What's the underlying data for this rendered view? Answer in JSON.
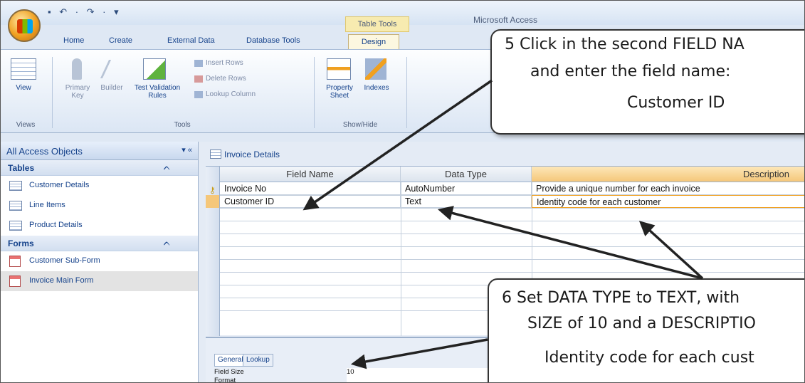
{
  "window": {
    "app_title": "Microsoft Access",
    "quick_access": "▪ ↶ · ↷ · ▾",
    "context_label": "Table Tools"
  },
  "ribbon_tabs": [
    "Home",
    "Create",
    "External Data",
    "Database Tools",
    "Design"
  ],
  "ribbon": {
    "view_label": "View",
    "primary_key_label": "Primary\nKey",
    "builder_label": "Builder",
    "test_validation_label": "Test Validation\nRules",
    "insert_rows_label": "Insert Rows",
    "delete_rows_label": "Delete Rows",
    "lookup_column_label": "Lookup Column",
    "property_sheet_label": "Property\nSheet",
    "indexes_label": "Indexes",
    "groups": [
      "Views",
      "Tools",
      "Show/Hide"
    ]
  },
  "nav_pane": {
    "header": "All Access Objects",
    "sections": [
      {
        "title": "Tables",
        "items": [
          "Customer Details",
          "Line Items",
          "Product Details"
        ]
      },
      {
        "title": "Forms",
        "items": [
          "Customer Sub-Form",
          "Invoice Main Form"
        ]
      }
    ]
  },
  "document": {
    "tab_label": "Invoice Details",
    "columns": [
      "Field Name",
      "Data Type",
      "Description"
    ],
    "rows": [
      {
        "field": "Invoice No",
        "type": "AutoNumber",
        "description": "Provide a unique number for each invoice"
      },
      {
        "field": "Customer ID",
        "type": "Text",
        "description": "Identity code for each customer"
      }
    ]
  },
  "properties": {
    "tabs": [
      "General",
      "Lookup"
    ],
    "rows": [
      {
        "label": "Field Size",
        "value": "10"
      },
      {
        "label": "Format",
        "value": ""
      }
    ]
  },
  "callouts": {
    "step5_line1": "5  Click in the second FIELD NA",
    "step5_line2": "and enter the field name:",
    "step5_line3": "Customer ID",
    "step6_line1": "6  Set DATA TYPE to TEXT, with",
    "step6_line2": "SIZE of 10 and a DESCRIPTIO",
    "step6_line3": "Identity code for each cust"
  }
}
